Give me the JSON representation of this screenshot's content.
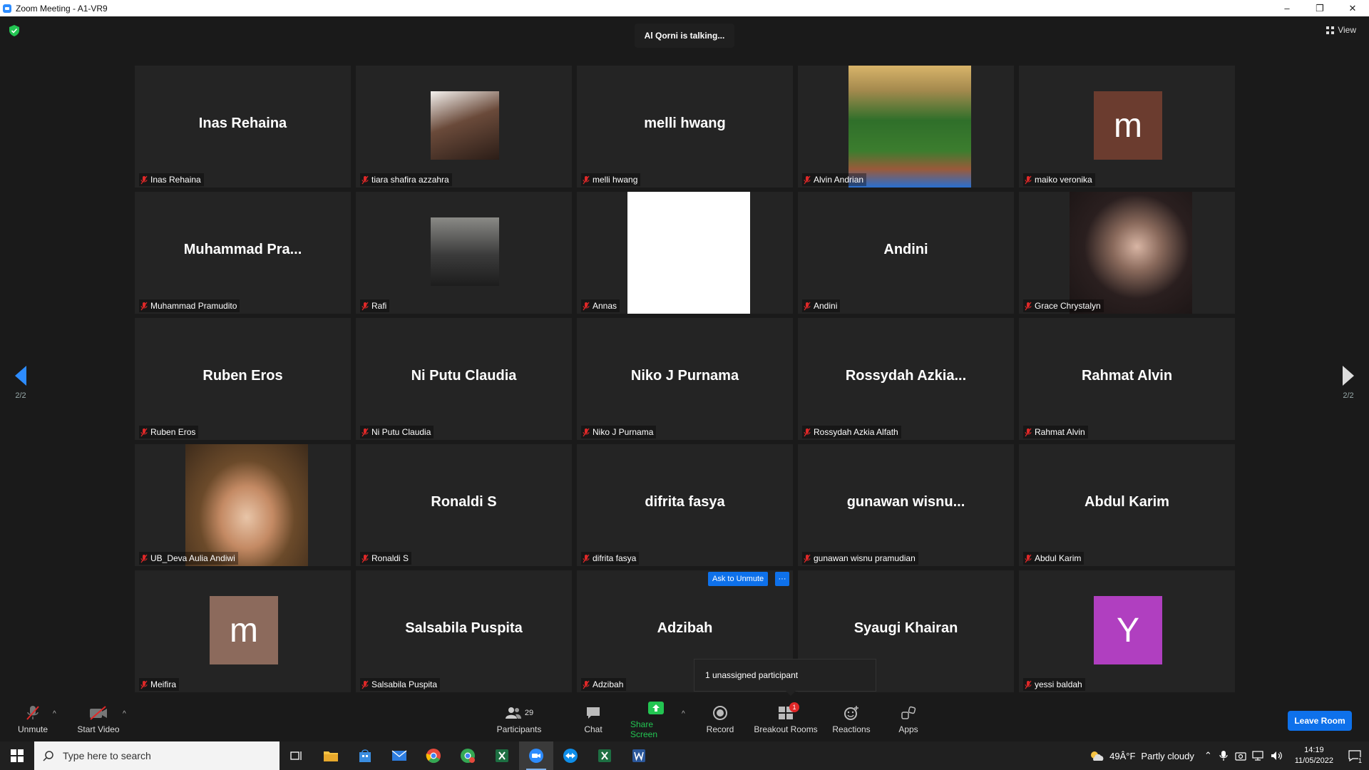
{
  "window": {
    "title": "Zoom Meeting - A1-VR9",
    "controls": [
      "–",
      "❐",
      "✕"
    ]
  },
  "meeting": {
    "talking_indicator": "Al Qorni is talking...",
    "view_label": "View",
    "page_left": "2/2",
    "page_right": "2/2",
    "ask_to_unmute": "Ask to Unmute",
    "more": "···",
    "unassigned": "1 unassigned participant"
  },
  "tiles": [
    {
      "big": "Inas Rehaina",
      "label": "Inas Rehaina",
      "media": "name"
    },
    {
      "big": "",
      "label": "tiara shafira azzahra",
      "media": "photo"
    },
    {
      "big": "melli hwang",
      "label": "melli hwang",
      "media": "name"
    },
    {
      "big": "",
      "label": "Alvin Andrian",
      "media": "photo"
    },
    {
      "big": "m",
      "label": "maiko veronika",
      "media": "letter",
      "color": "#6b3c2f"
    },
    {
      "big": "Muhammad  Pra...",
      "label": "Muhammad Pramudito",
      "media": "name"
    },
    {
      "big": "",
      "label": "Rafi",
      "media": "photo"
    },
    {
      "big": "",
      "label": "Annas",
      "media": "white"
    },
    {
      "big": "Andini",
      "label": "Andini",
      "media": "name"
    },
    {
      "big": "",
      "label": "Grace Chrystalyn",
      "media": "photo"
    },
    {
      "big": "Ruben Eros",
      "label": "Ruben Eros",
      "media": "name"
    },
    {
      "big": "Ni Putu Claudia",
      "label": "Ni Putu Claudia",
      "media": "name"
    },
    {
      "big": "Niko J Purnama",
      "label": "Niko J Purnama",
      "media": "name"
    },
    {
      "big": "Rossydah  Azkia...",
      "label": "Rossydah Azkia Alfath",
      "media": "name"
    },
    {
      "big": "Rahmat Alvin",
      "label": "Rahmat Alvin",
      "media": "name"
    },
    {
      "big": "",
      "label": "UB_Deva Aulia Andiwi",
      "media": "photo"
    },
    {
      "big": "Ronaldi S",
      "label": "Ronaldi S",
      "media": "name"
    },
    {
      "big": "difrita fasya",
      "label": "difrita fasya",
      "media": "name"
    },
    {
      "big": "gunawan  wisnu...",
      "label": "gunawan wisnu pramudian",
      "media": "name"
    },
    {
      "big": "Abdul Karim",
      "label": "Abdul Karim",
      "media": "name"
    },
    {
      "big": "m",
      "label": "Meifira",
      "media": "letter",
      "color": "#8c6a5c"
    },
    {
      "big": "Salsabila Puspita",
      "label": "Salsabila Puspita",
      "media": "name"
    },
    {
      "big": "Adzibah",
      "label": "Adzibah",
      "media": "name"
    },
    {
      "big": "Syaugi Khairan",
      "label": "",
      "media": "name"
    },
    {
      "big": "Y",
      "label": "yessi baldah",
      "media": "letter",
      "color": "#b03fc0"
    }
  ],
  "toolbar": {
    "unmute": "Unmute",
    "start_video": "Start Video",
    "participants": "Participants",
    "participants_count": "29",
    "chat": "Chat",
    "share_screen": "Share Screen",
    "record": "Record",
    "breakout_rooms": "Breakout Rooms",
    "breakout_badge": "1",
    "reactions": "Reactions",
    "apps": "Apps",
    "leave_room": "Leave Room"
  },
  "taskbar": {
    "search_placeholder": "Type here to search",
    "weather": "49Â°F",
    "weather_desc": "Partly cloudy",
    "time": "14:19",
    "date": "11/05/2022",
    "notification_count": "1"
  },
  "colors": {
    "accent": "#0e71eb",
    "share_green": "#23c552",
    "mic_red": "#e02828"
  }
}
